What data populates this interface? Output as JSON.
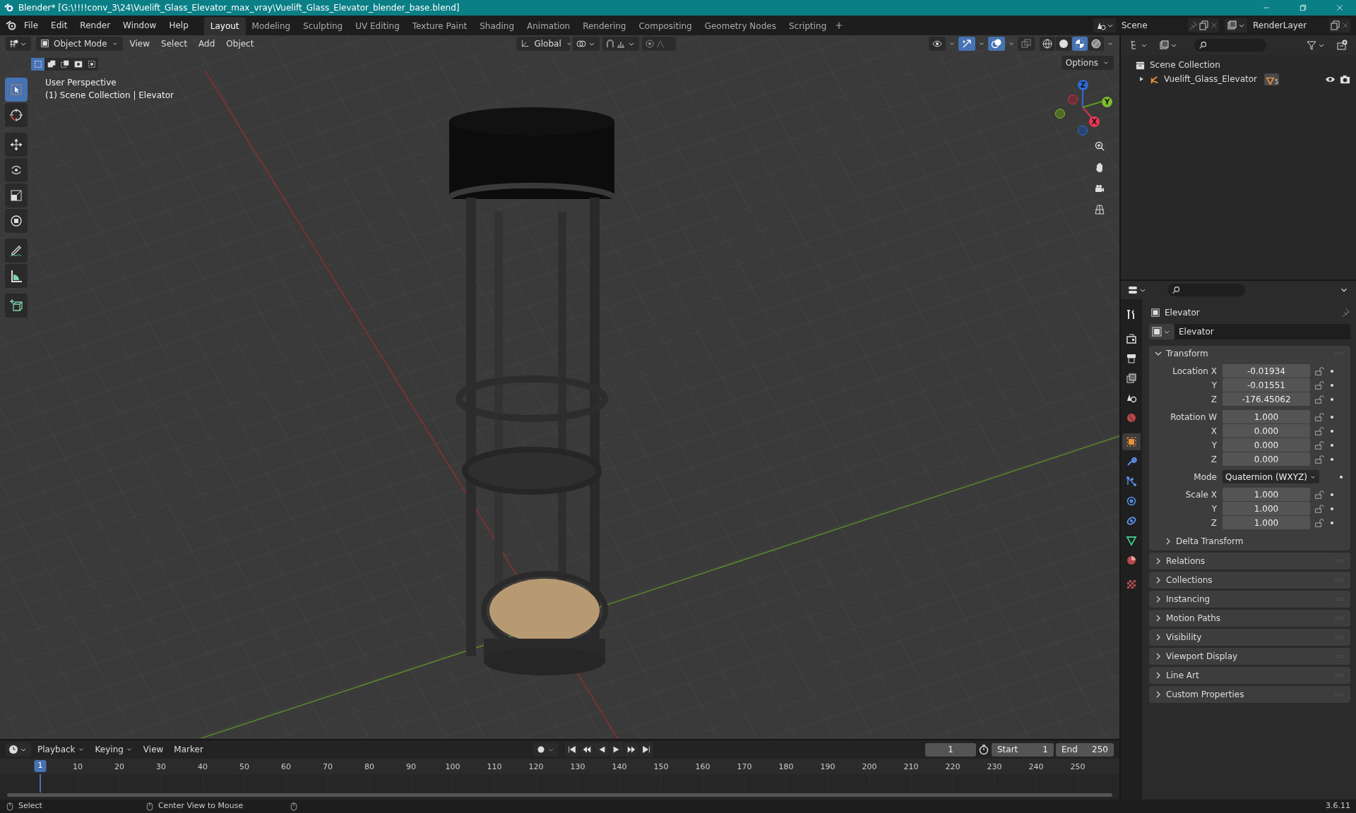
{
  "window": {
    "title": "Blender* [G:\\!!!!conv_3\\24\\Vuelift_Glass_Elevator_max_vray\\Vuelift_Glass_Elevator_blender_base.blend]"
  },
  "menu": [
    "File",
    "Edit",
    "Render",
    "Window",
    "Help"
  ],
  "workspaces": [
    {
      "label": "Layout",
      "selected": true
    },
    {
      "label": "Modeling",
      "selected": false
    },
    {
      "label": "Sculpting",
      "selected": false
    },
    {
      "label": "UV Editing",
      "selected": false
    },
    {
      "label": "Texture Paint",
      "selected": false
    },
    {
      "label": "Shading",
      "selected": false
    },
    {
      "label": "Animation",
      "selected": false
    },
    {
      "label": "Rendering",
      "selected": false
    },
    {
      "label": "Compositing",
      "selected": false
    },
    {
      "label": "Geometry Nodes",
      "selected": false
    },
    {
      "label": "Scripting",
      "selected": false
    }
  ],
  "scene": {
    "name": "Scene"
  },
  "view_layer": {
    "name": "RenderLayer"
  },
  "viewport": {
    "mode": "Object Mode",
    "menus": [
      "View",
      "Select",
      "Add",
      "Object"
    ],
    "orientation": "Global",
    "options": "Options",
    "select_modes": [
      {
        "kind": "new",
        "selected": true
      },
      {
        "kind": "extend",
        "selected": false
      },
      {
        "kind": "subtract",
        "selected": false
      },
      {
        "kind": "invert",
        "selected": false
      },
      {
        "kind": "intersect",
        "selected": false
      }
    ],
    "toggles": [
      {
        "kind": "visibility",
        "on": false
      },
      {
        "kind": "gizmos",
        "on": true
      },
      {
        "kind": "overlays",
        "on": true
      },
      {
        "kind": "xray",
        "on": false
      }
    ],
    "shading": [
      {
        "kind": "wireframe",
        "selected": false
      },
      {
        "kind": "solid",
        "selected": false
      },
      {
        "kind": "material",
        "selected": true
      },
      {
        "kind": "rendered",
        "selected": false
      }
    ],
    "overlay_lines": [
      "User Perspective",
      "(1) Scene Collection | Elevator"
    ],
    "tools": [
      {
        "kind": "select",
        "selected": true
      },
      {
        "kind": "cursor",
        "selected": false
      },
      {
        "kind": "move",
        "selected": false
      },
      {
        "kind": "rotate",
        "selected": false
      },
      {
        "kind": "scale",
        "selected": false
      },
      {
        "kind": "transform",
        "selected": false
      },
      {
        "kind": "annotate",
        "selected": false
      },
      {
        "kind": "measure",
        "selected": false
      },
      {
        "kind": "add-cube",
        "selected": false
      }
    ],
    "gizmo": {
      "x": "X",
      "y": "Y",
      "z": "Z"
    }
  },
  "outliner": {
    "root": "Scene Collection",
    "items": [
      {
        "label": "Vuelift_Glass_Elevator",
        "expanded": false,
        "count": "5"
      }
    ]
  },
  "properties": {
    "object_name": "Elevator",
    "datablock": "Elevator",
    "tabs": [
      {
        "kind": "tool",
        "selected": false
      },
      {
        "kind": "render",
        "selected": false
      },
      {
        "kind": "output",
        "selected": false
      },
      {
        "kind": "view-layer",
        "selected": false
      },
      {
        "kind": "scene",
        "selected": false
      },
      {
        "kind": "world",
        "selected": false
      },
      {
        "kind": "object",
        "selected": true
      },
      {
        "kind": "modifiers",
        "selected": false
      },
      {
        "kind": "particles",
        "selected": false
      },
      {
        "kind": "physics",
        "selected": false
      },
      {
        "kind": "constraints",
        "selected": false
      },
      {
        "kind": "data",
        "selected": false
      },
      {
        "kind": "material",
        "selected": false
      },
      {
        "kind": "texture",
        "selected": false
      }
    ],
    "transform": {
      "label": "Transform",
      "expanded": true,
      "groups": [
        {
          "rows": [
            {
              "kind": "number",
              "label": "Location X",
              "value": "-0.01934"
            },
            {
              "kind": "number",
              "label": "Y",
              "value": "-0.01551"
            },
            {
              "kind": "number",
              "label": "Z",
              "value": "-176.45062"
            }
          ]
        },
        {
          "rows": [
            {
              "kind": "number",
              "label": "Rotation W",
              "value": "1.000"
            },
            {
              "kind": "number",
              "label": "X",
              "value": "0.000"
            },
            {
              "kind": "number",
              "label": "Y",
              "value": "0.000"
            },
            {
              "kind": "number",
              "label": "Z",
              "value": "0.000"
            }
          ]
        },
        {
          "rows": [
            {
              "kind": "dropdown",
              "label": "Mode",
              "value": "Quaternion (WXYZ)"
            }
          ]
        },
        {
          "rows": [
            {
              "kind": "number",
              "label": "Scale X",
              "value": "1.000"
            },
            {
              "kind": "number",
              "label": "Y",
              "value": "1.000"
            },
            {
              "kind": "number",
              "label": "Z",
              "value": "1.000"
            }
          ]
        }
      ],
      "subpanel": {
        "label": "Delta Transform",
        "expanded": false
      }
    },
    "panels": [
      {
        "label": "Relations",
        "expanded": false
      },
      {
        "label": "Collections",
        "expanded": false
      },
      {
        "label": "Instancing",
        "expanded": false
      },
      {
        "label": "Motion Paths",
        "expanded": false
      },
      {
        "label": "Visibility",
        "expanded": false
      },
      {
        "label": "Viewport Display",
        "expanded": false
      },
      {
        "label": "Line Art",
        "expanded": false
      },
      {
        "label": "Custom Properties",
        "expanded": false
      }
    ]
  },
  "timeline": {
    "menus": [
      "Playback",
      "Keying",
      "View",
      "Marker"
    ],
    "current_frame": "1",
    "start_label": "Start",
    "start": "1",
    "end_label": "End",
    "end": "250",
    "ruler": [
      "1",
      "10",
      "20",
      "30",
      "40",
      "50",
      "60",
      "70",
      "80",
      "90",
      "100",
      "110",
      "120",
      "130",
      "140",
      "150",
      "160",
      "170",
      "180",
      "190",
      "200",
      "210",
      "220",
      "230",
      "240",
      "250"
    ]
  },
  "status_bar": {
    "items": [
      "Select",
      "Center View to Mouse"
    ],
    "version": "3.6.11"
  }
}
